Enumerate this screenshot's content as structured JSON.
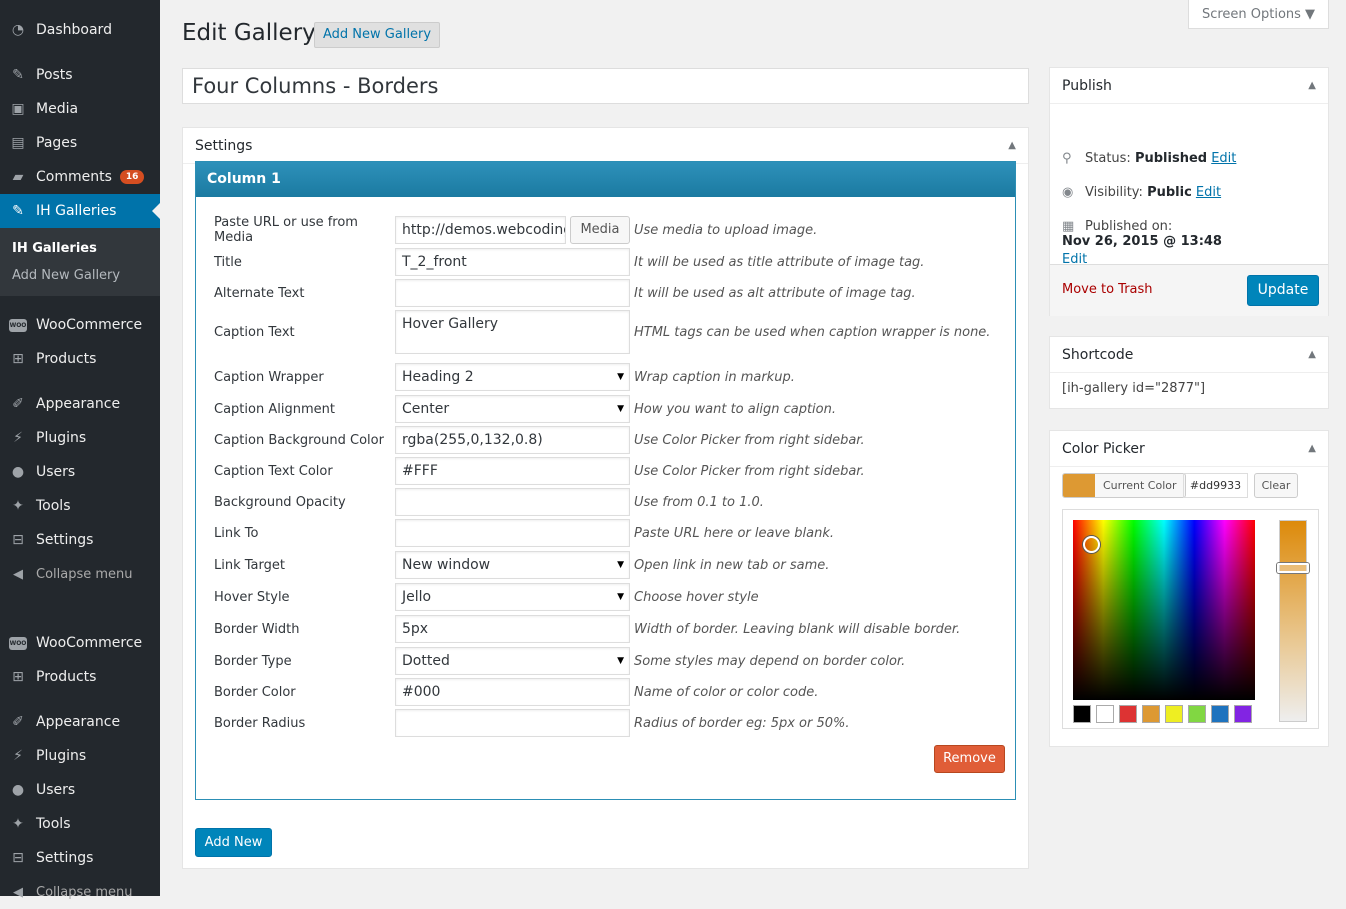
{
  "sidebar": {
    "items": [
      {
        "label": "Dashboard",
        "icon": "dashboard-icon"
      },
      {
        "label": "Posts",
        "icon": "pushpin-icon"
      },
      {
        "label": "Media",
        "icon": "media-icon"
      },
      {
        "label": "Pages",
        "icon": "pages-icon"
      },
      {
        "label": "Comments",
        "icon": "comment-icon",
        "badge": "16"
      },
      {
        "label": "IH Galleries",
        "icon": "pushpin-icon"
      },
      {
        "label": "WooCommerce",
        "icon": "woo-icon"
      },
      {
        "label": "Products",
        "icon": "cart-icon"
      },
      {
        "label": "Appearance",
        "icon": "brush-icon"
      },
      {
        "label": "Plugins",
        "icon": "plug-icon"
      },
      {
        "label": "Users",
        "icon": "user-icon"
      },
      {
        "label": "Tools",
        "icon": "wrench-icon"
      },
      {
        "label": "Settings",
        "icon": "settings-icon"
      },
      {
        "label": "Collapse menu",
        "icon": "collapse-icon"
      }
    ],
    "submenu": [
      "IH Galleries",
      "Add New Gallery"
    ],
    "woo_badge": "WOO"
  },
  "header": {
    "title": "Edit Gallery",
    "add_new": "Add New Gallery",
    "screen_options": "Screen Options ▼"
  },
  "post_title": "Four Columns - Borders",
  "settings": {
    "title": "Settings",
    "column_title": "Column 1",
    "media_button": "Media",
    "fields": [
      {
        "label": "Paste URL or use from Media",
        "value": "http://demos.webcoding",
        "hint": "Use media to upload image."
      },
      {
        "label": "Title",
        "value": "T_2_front",
        "hint": "It will be used as title attribute of image tag."
      },
      {
        "label": "Alternate Text",
        "value": "",
        "hint": "It will be used as alt attribute of image tag."
      },
      {
        "label": "Caption Text",
        "value": "Hover Gallery",
        "hint": "HTML tags can be used when caption wrapper is none."
      },
      {
        "label": "Caption Wrapper",
        "value": "Heading 2",
        "hint": "Wrap caption in markup."
      },
      {
        "label": "Caption Alignment",
        "value": "Center",
        "hint": "How you want to align caption."
      },
      {
        "label": "Caption Background Color",
        "value": "rgba(255,0,132,0.8)",
        "hint": "Use Color Picker from right sidebar."
      },
      {
        "label": "Caption Text Color",
        "value": "#FFF",
        "hint": "Use Color Picker from right sidebar."
      },
      {
        "label": "Background Opacity",
        "value": "",
        "hint": "Use from 0.1 to 1.0."
      },
      {
        "label": "Link To",
        "value": "",
        "hint": "Paste URL here or leave blank."
      },
      {
        "label": "Link Target",
        "value": "New window",
        "hint": "Open link in new tab or same."
      },
      {
        "label": "Hover Style",
        "value": "Jello",
        "hint": "Choose hover style"
      },
      {
        "label": "Border Width",
        "value": "5px",
        "hint": "Width of border. Leaving blank will disable border."
      },
      {
        "label": "Border Type",
        "value": "Dotted",
        "hint": "Some styles may depend on border color."
      },
      {
        "label": "Border Color",
        "value": "#000",
        "hint": "Name of color or color code."
      },
      {
        "label": "Border Radius",
        "value": "",
        "hint": "Radius of border eg: 5px or 50%."
      }
    ],
    "remove_button": "Remove",
    "add_new_button": "Add New"
  },
  "publish": {
    "title": "Publish",
    "status_label": "Status:",
    "status_value": "Published",
    "visibility_label": "Visibility:",
    "visibility_value": "Public",
    "published_label": "Published on:",
    "published_value": "Nov 26, 2015 @ 13:48",
    "edit": "Edit",
    "trash": "Move to Trash",
    "update": "Update"
  },
  "shortcode": {
    "title": "Shortcode",
    "value": "[ih-gallery id=\"2877\"]"
  },
  "color_picker": {
    "title": "Color Picker",
    "current_label": "Current Color",
    "current_value": "#dd9933",
    "clear": "Clear",
    "current_color": "#dd9933",
    "swatches": [
      "#000000",
      "#ffffff",
      "#dd3333",
      "#dd9933",
      "#eeee22",
      "#81d742",
      "#1e73be",
      "#8224e3"
    ]
  }
}
